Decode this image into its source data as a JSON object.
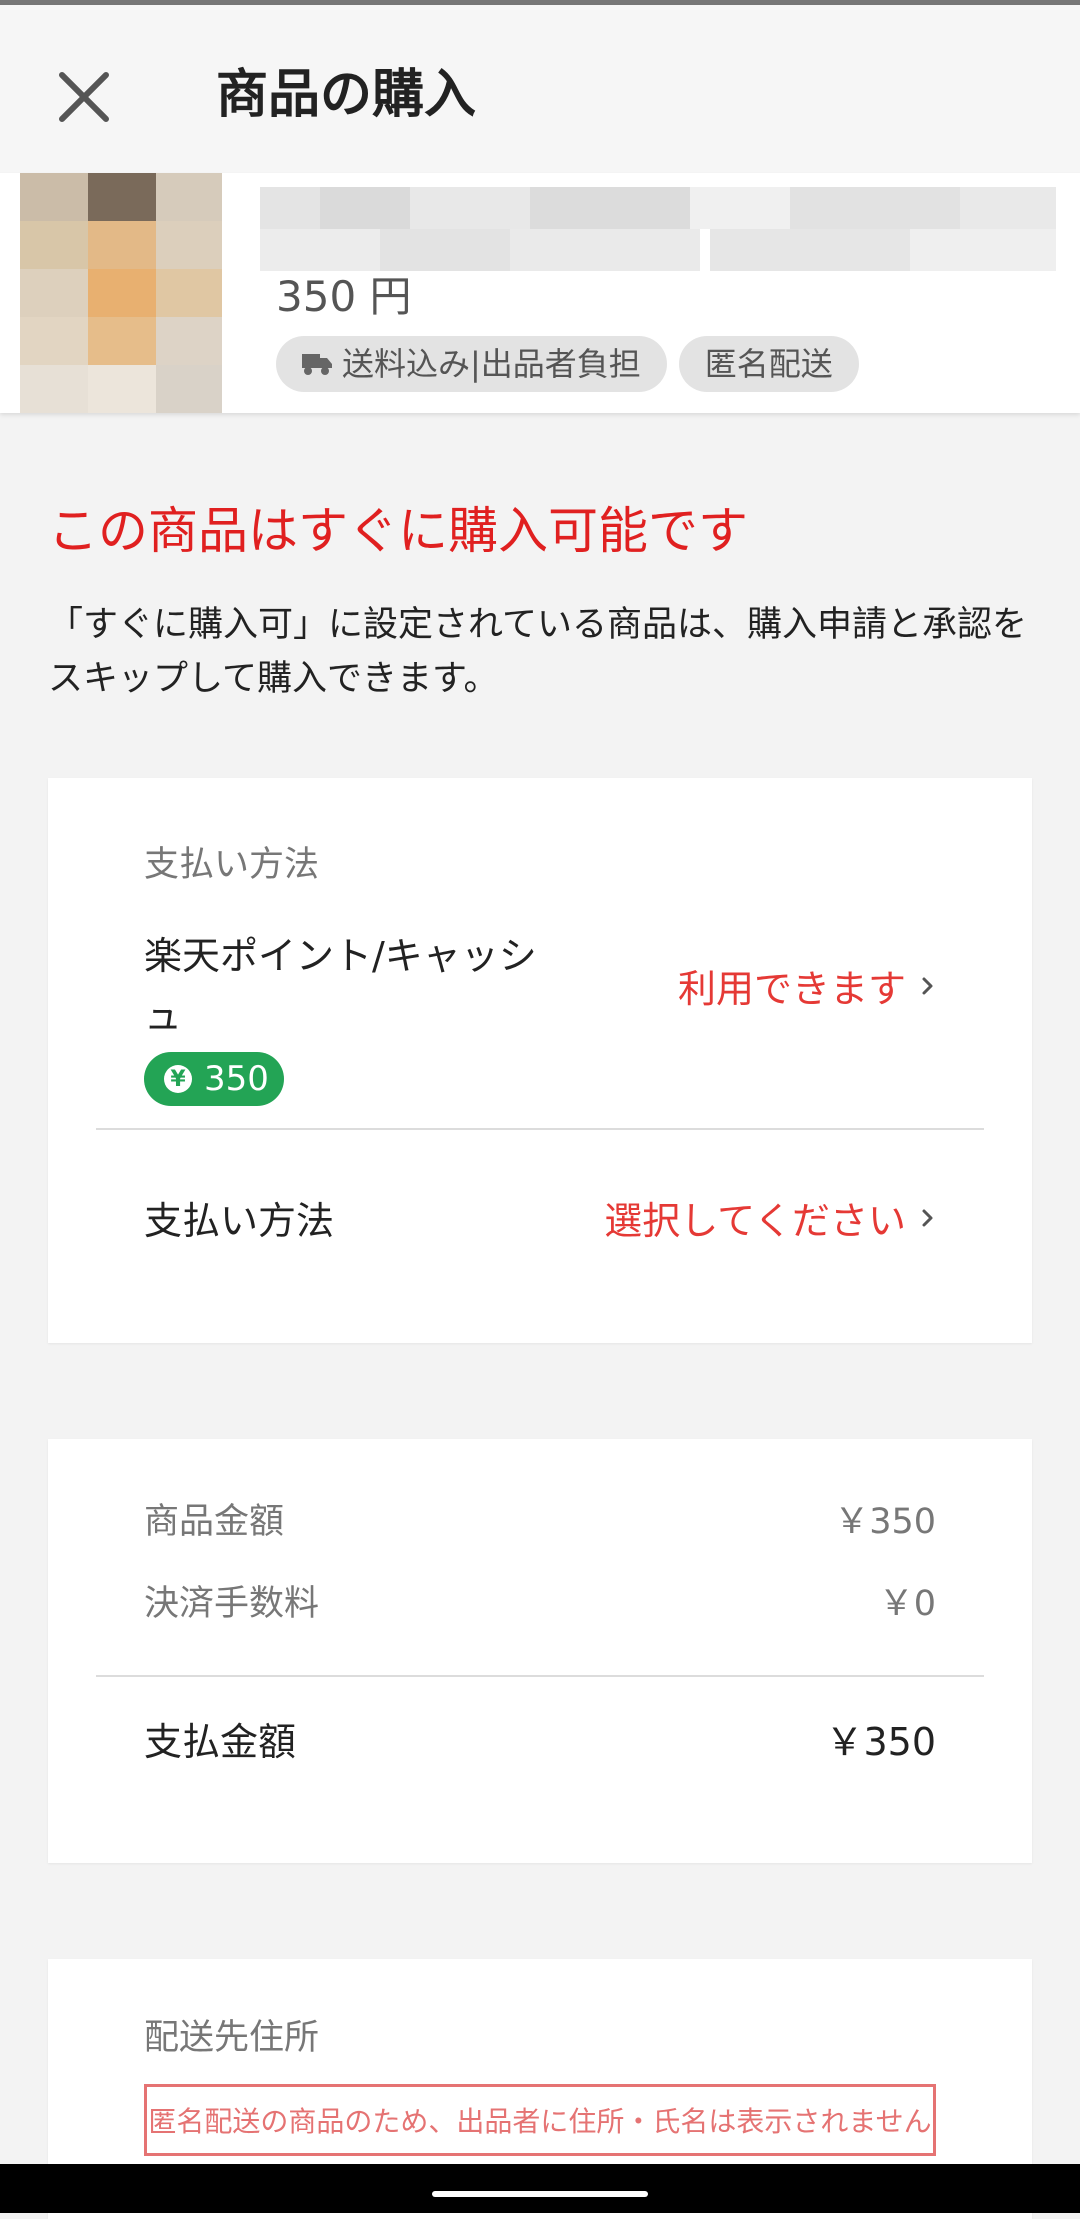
{
  "appbar": {
    "title": "商品の購入"
  },
  "item": {
    "price": "350 円",
    "tags": [
      "送料込み|出品者負担",
      "匿名配送"
    ]
  },
  "availability": {
    "heading": "この商品はすぐに購入可能です",
    "description": "「すぐに購入可」に設定されている商品は、購入申請と承認をスキップして購入できます。"
  },
  "payment": {
    "section_label": "支払い方法",
    "points_label_line1": "楽天ポイント/キャッシ",
    "points_label_line2": "ュ",
    "points_status": "利用できます",
    "points_balance": "350",
    "method_label": "支払い方法",
    "method_status": "選択してください"
  },
  "price_summary": {
    "item_price_label": "商品金額",
    "item_price_value": "￥350",
    "fee_label": "決済手数料",
    "fee_value": "￥0",
    "total_label": "支払金額",
    "total_value": "￥350"
  },
  "address": {
    "section_label": "配送先住所",
    "notice": "匿名配送の商品のため、出品者に住所・氏名は表示されません"
  },
  "colors": {
    "accent_red": "#e53935",
    "heading_red": "#e02020",
    "point_green": "#23a455"
  }
}
